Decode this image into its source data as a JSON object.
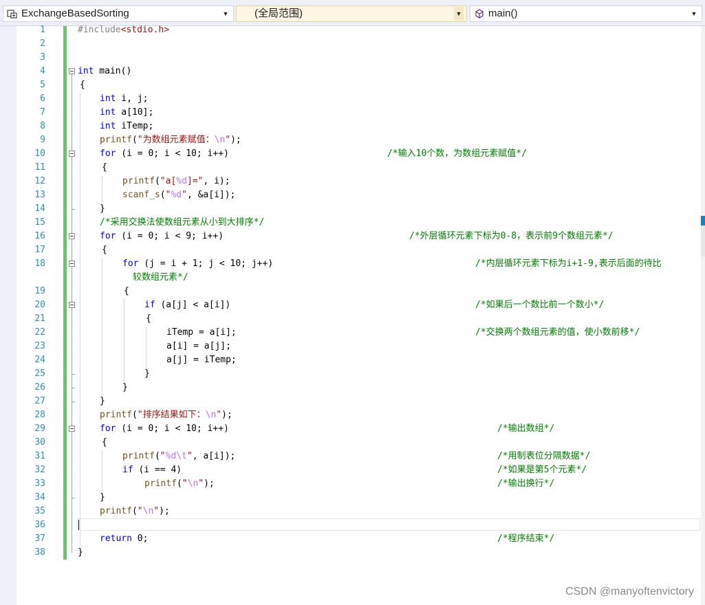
{
  "navbar": {
    "project": "ExchangeBasedSorting",
    "scope": "(全局范围)",
    "member": "main()"
  },
  "lines": {
    "n1": "1",
    "n2": "2",
    "n3": "3",
    "n4": "4",
    "n5": "5",
    "n6": "6",
    "n7": "7",
    "n8": "8",
    "n9": "9",
    "n10": "10",
    "n11": "11",
    "n12": "12",
    "n13": "13",
    "n14": "14",
    "n15": "15",
    "n16": "16",
    "n17": "17",
    "n18": "18",
    "n19": "19",
    "n20": "20",
    "n21": "21",
    "n22": "22",
    "n23": "23",
    "n24": "24",
    "n25": "25",
    "n26": "26",
    "n27": "27",
    "n28": "28",
    "n29": "29",
    "n30": "30",
    "n31": "31",
    "n32": "32",
    "n33": "33",
    "n34": "34",
    "n35": "35",
    "n36": "36",
    "n37": "37",
    "n38": "38"
  },
  "code": {
    "l1_pp": "#include",
    "l1_hdr": "<stdio.h>",
    "l4_kw": "int",
    "l4_rest": " main()",
    "l5": "{",
    "l6_kw": "int",
    "l6_rest": " i, j;",
    "l7_kw": "int",
    "l7_rest": " a[10];",
    "l8_kw": "int",
    "l8_rest": " iTemp;",
    "l9_fn": "printf",
    "l9_a": "(",
    "l9_str": "\"为数组元素赋值：",
    "l9_esc": "\\n",
    "l9_str2": "\"",
    "l9_b": ");",
    "l10_kw": "for",
    "l10_rest": " (i = 0; i < 10; i++)",
    "l10_cm": "/*输入10个数，为数组元素赋值*/",
    "l11": "{",
    "l12_fn": "printf",
    "l12_a": "(",
    "l12_str": "\"a[",
    "l12_esc": "%d",
    "l12_str2": "]=\"",
    "l12_b": ", i);",
    "l13_fn": "scanf_s",
    "l13_a": "(",
    "l13_str": "\"",
    "l13_esc": "%d",
    "l13_str2": "\"",
    "l13_b": ", &a[i]);",
    "l14": "}",
    "l15_cm": "/*采用交换法使数组元素从小到大排序*/",
    "l16_kw": "for",
    "l16_rest": " (i = 0; i < 9; i++)",
    "l16_cm": "/*外层循环元素下标为0-8，表示前9个数组元素*/",
    "l17": "{",
    "l18_kw": "for",
    "l18_rest": " (j = i + 1; j < 10; j++)",
    "l18_cm": "/*内层循环元素下标为i+1-9,表示后面的待比",
    "l18_cm2": "较数组元素*/",
    "l19": "{",
    "l20_kw": "if",
    "l20_rest": " (a[j] < a[i])",
    "l20_cm": "/*如果后一个数比前一个数小*/",
    "l21": "{",
    "l22": "iTemp = a[i];",
    "l22_cm": "/*交换两个数组元素的值，使小数前移*/",
    "l23": "a[i] = a[j];",
    "l24": "a[j] = iTemp;",
    "l25": "}",
    "l26": "}",
    "l27": "}",
    "l28_fn": "printf",
    "l28_a": "(",
    "l28_str": "\"排序结果如下：",
    "l28_esc": "\\n",
    "l28_str2": "\"",
    "l28_b": ");",
    "l29_kw": "for",
    "l29_rest": " (i = 0; i < 10; i++)",
    "l29_cm": "/*输出数组*/",
    "l30": "{",
    "l31_fn": "printf",
    "l31_a": "(",
    "l31_str": "\"",
    "l31_esc": "%d\\t",
    "l31_str2": "\"",
    "l31_b": ", a[i]);",
    "l31_cm": "/*用制表位分隔数据*/",
    "l32_kw": "if",
    "l32_rest": " (i == 4)",
    "l32_cm": "/*如果是第5个元素*/",
    "l33_fn": "printf",
    "l33_a": "(",
    "l33_str": "\"",
    "l33_esc": "\\n",
    "l33_str2": "\"",
    "l33_b": ");",
    "l33_cm": "/*输出换行*/",
    "l34": "}",
    "l35_fn": "printf",
    "l35_a": "(",
    "l35_str": "\"",
    "l35_esc": "\\n",
    "l35_str2": "\"",
    "l35_b": ");",
    "l37_kw": "return",
    "l37_rest": " 0;",
    "l37_cm": "/*程序结束*/",
    "l38": "}"
  },
  "watermark": "CSDN @manyoftenvictory",
  "colors": {
    "keyword": "#0000ff",
    "string": "#a31515",
    "escape": "#b776fb",
    "comment": "#008000",
    "line_number": "#2b91af",
    "change_bar": "#6cc46e"
  }
}
